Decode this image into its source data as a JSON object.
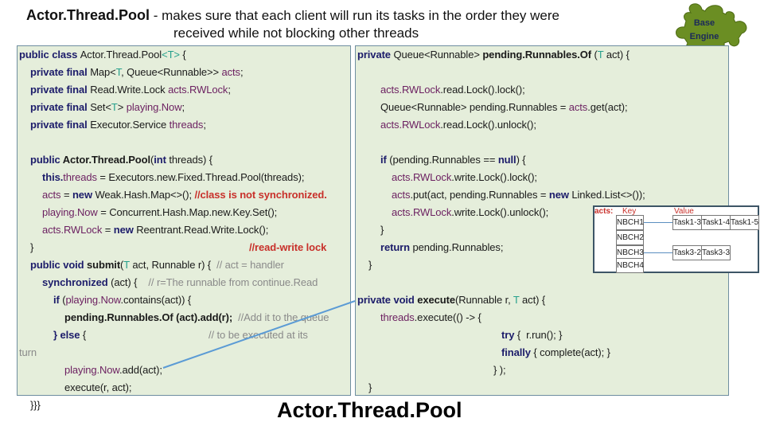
{
  "title": {
    "main": "Actor.Thread.Pool",
    "rest": " - makes sure that each client will run its tasks in the order they were",
    "line2": "received while not blocking other threads"
  },
  "badge": {
    "line1": "Base",
    "line2": "Engine",
    "color": "#6b8e23"
  },
  "footer": "Actor.Thread.Pool",
  "colors": {
    "keyword": "#1c1c6a",
    "field": "#6b1f60",
    "type_param": "#26a08c",
    "comment": "#8a8a8a",
    "red_comment": "#c8302a",
    "box_bg": "#e5eedb"
  },
  "left_code": [
    [
      [
        "k",
        "public class "
      ],
      [
        "n",
        "Actor.Thread.Pool"
      ],
      [
        "t",
        "<T>"
      ],
      [
        "n",
        " {"
      ]
    ],
    [
      [
        "k",
        "private final "
      ],
      [
        "n",
        "Map<"
      ],
      [
        "t",
        "T"
      ],
      [
        "n",
        ", Queue<Runnable>> "
      ],
      [
        "f",
        "acts"
      ],
      [
        "n",
        ";"
      ]
    ],
    [
      [
        "k",
        "private final "
      ],
      [
        "n",
        "Read.Write.Lock "
      ],
      [
        "f",
        "acts.RWLock"
      ],
      [
        "n",
        ";"
      ]
    ],
    [
      [
        "k",
        "private final "
      ],
      [
        "n",
        "Set<"
      ],
      [
        "t",
        "T"
      ],
      [
        "n",
        "> "
      ],
      [
        "f",
        "playing.Now"
      ],
      [
        "n",
        ";"
      ]
    ],
    [
      [
        "k",
        "private final "
      ],
      [
        "n",
        "Executor.Service "
      ],
      [
        "f",
        "threads"
      ],
      [
        "n",
        ";"
      ]
    ],
    [
      [
        "k",
        "public "
      ],
      [
        "b",
        "Actor.Thread.Pool"
      ],
      [
        "n",
        "("
      ],
      [
        "k",
        "int "
      ],
      [
        "n",
        "threads) {"
      ]
    ],
    [
      [
        "k",
        "this."
      ],
      [
        "f",
        "threads"
      ],
      [
        "n",
        " = Executors.new.Fixed.Thread.Pool(threads);"
      ]
    ],
    [
      [
        "f",
        "acts"
      ],
      [
        "n",
        " = "
      ],
      [
        "k",
        "new "
      ],
      [
        "n",
        "Weak.Hash.Map<>(); "
      ],
      [
        "r",
        "//class is not synchronized."
      ]
    ],
    [
      [
        "f",
        "playing.Now"
      ],
      [
        "n",
        " = Concurrent.Hash.Map.new.Key.Set();"
      ]
    ],
    [
      [
        "f",
        "acts.RWLock"
      ],
      [
        "n",
        " = "
      ],
      [
        "k",
        "new "
      ],
      [
        "n",
        "Reentrant.Read.Write.Lock();"
      ]
    ],
    [
      [
        "n",
        "}"
      ]
    ],
    [
      [
        "r",
        "//read-write lock"
      ]
    ],
    [
      [
        "k",
        "public void "
      ],
      [
        "b",
        "submit"
      ],
      [
        "n",
        "("
      ],
      [
        "t",
        "T"
      ],
      [
        "n",
        " act, Runnable r) {  "
      ],
      [
        "c",
        "// act = handler"
      ]
    ],
    [
      [
        "k",
        "synchronized "
      ],
      [
        "n",
        "(act) {    "
      ],
      [
        "c",
        "// r=The runnable from continue.Read"
      ]
    ],
    [
      [
        "k",
        "if "
      ],
      [
        "n",
        "("
      ],
      [
        "f",
        "playing.Now"
      ],
      [
        "n",
        ".contains(act)) {"
      ]
    ],
    [
      [
        "b",
        "pending.Runnables.Of (act).add(r);  "
      ],
      [
        "c",
        "//Add it to the queue"
      ]
    ],
    [
      [
        "k",
        "} else "
      ],
      [
        "n",
        "{"
      ]
    ],
    [
      [
        "c",
        "// to be executed at its"
      ]
    ],
    [
      [
        "c",
        "turn"
      ]
    ],
    [
      [
        "f",
        "playing.Now"
      ],
      [
        "n",
        ".add(act);"
      ]
    ],
    [
      [
        "n",
        "execute(r, act);"
      ]
    ],
    [
      [
        "n",
        "}}}"
      ]
    ]
  ],
  "right_code": [
    [
      [
        "k",
        "private "
      ],
      [
        "n",
        "Queue<Runnable> "
      ],
      [
        "b",
        "pending.Runnables.Of"
      ],
      [
        "n",
        " ("
      ],
      [
        "t",
        "T"
      ],
      [
        "n",
        " act) {"
      ]
    ],
    [
      [
        "f",
        "acts.RWLock"
      ],
      [
        "n",
        ".read.Lock().lock();"
      ]
    ],
    [
      [
        "n",
        "Queue<Runnable> pending.Runnables = "
      ],
      [
        "f",
        "acts"
      ],
      [
        "n",
        ".get(act);"
      ]
    ],
    [
      [
        "f",
        "acts.RWLock"
      ],
      [
        "n",
        ".read.Lock().unlock();"
      ]
    ],
    [
      [
        "k",
        "if "
      ],
      [
        "n",
        "(pending.Runnables == "
      ],
      [
        "k",
        "null"
      ],
      [
        "n",
        ") {"
      ]
    ],
    [
      [
        "f",
        "acts.RWLock"
      ],
      [
        "n",
        ".write.Lock().lock();"
      ]
    ],
    [
      [
        "f",
        "acts"
      ],
      [
        "n",
        ".put(act, pending.Runnables = "
      ],
      [
        "k",
        "new "
      ],
      [
        "n",
        "Linked.List<>());"
      ]
    ],
    [
      [
        "f",
        "acts.RWLock"
      ],
      [
        "n",
        ".write.Lock().unlock();"
      ]
    ],
    [
      [
        "n",
        "}"
      ]
    ],
    [
      [
        "k",
        "return "
      ],
      [
        "n",
        "pending.Runnables;"
      ]
    ],
    [
      [
        "n",
        "}"
      ]
    ],
    [
      [
        "k",
        "private void "
      ],
      [
        "b",
        "execute"
      ],
      [
        "n",
        "(Runnable r, "
      ],
      [
        "t",
        "T"
      ],
      [
        "n",
        " act) {"
      ]
    ],
    [
      [
        "f",
        "threads"
      ],
      [
        "n",
        ".execute(() -> {"
      ]
    ],
    [
      [
        "k",
        "try "
      ],
      [
        "n",
        "{  r.run(); }"
      ]
    ],
    [
      [
        "k",
        "finally "
      ],
      [
        "n",
        "{ complete(act); }"
      ]
    ],
    [
      [
        "n",
        "} );"
      ]
    ],
    [
      [
        "n",
        "}"
      ]
    ]
  ],
  "acts_table": {
    "label": "acts:",
    "key_header": "Key",
    "value_header": "Value",
    "keys": [
      "NBCH1",
      "NBCH2",
      "NBCH3",
      "NBCH4"
    ],
    "values": {
      "NBCH1": [
        "Task1-3",
        "Task1-4",
        "Task1-5"
      ],
      "NBCH3": [
        "Task3-2",
        "Task3-3"
      ]
    }
  }
}
